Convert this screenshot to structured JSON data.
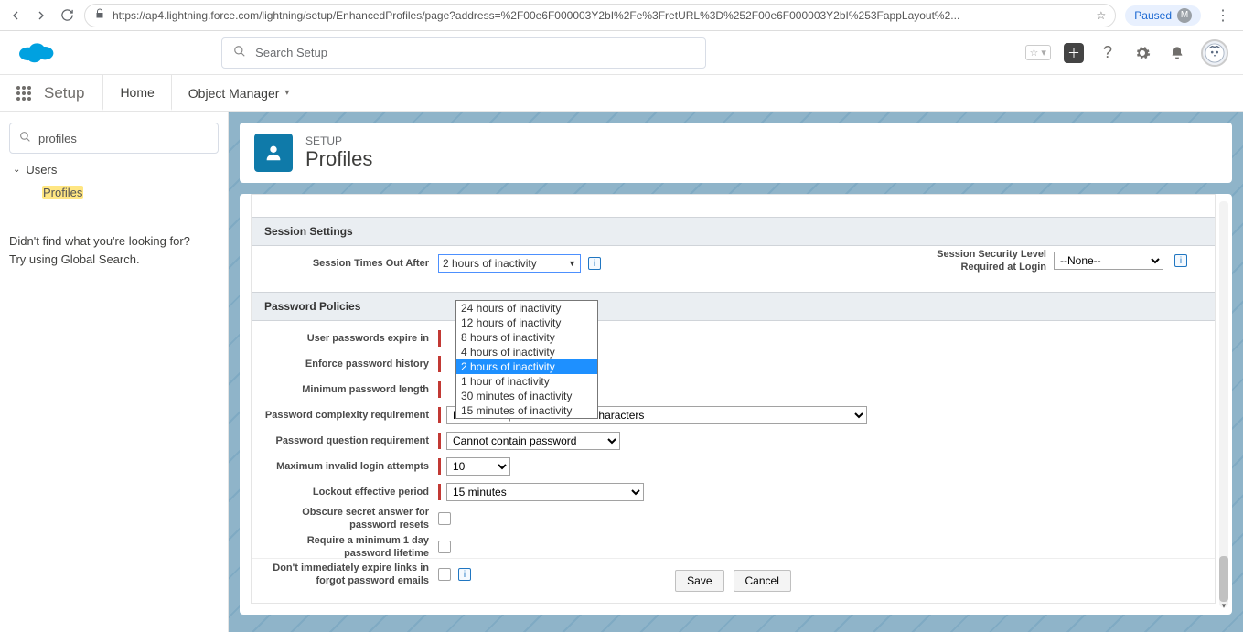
{
  "browser": {
    "url": "https://ap4.lightning.force.com/lightning/setup/EnhancedProfiles/page?address=%2F00e6F000003Y2bI%2Fe%3FretURL%3D%252F00e6F000003Y2bI%253FappLayout%2...",
    "paused": "Paused",
    "avatar_letter": "M"
  },
  "header": {
    "search_placeholder": "Search Setup"
  },
  "tabs": {
    "app_label": "Setup",
    "home": "Home",
    "object_manager": "Object Manager"
  },
  "sidebar": {
    "quickfind": "profiles",
    "users": "Users",
    "profiles": "Profiles",
    "footer1": "Didn't find what you're looking for?",
    "footer2": "Try using Global Search."
  },
  "page": {
    "sup": "SETUP",
    "title": "Profiles"
  },
  "sections": {
    "session": "Session Settings",
    "password": "Password Policies"
  },
  "session": {
    "timeout_label": "Session Times Out After",
    "timeout_selected": "2 hours of inactivity",
    "timeout_options": {
      "o1": "24 hours of inactivity",
      "o2": "12 hours of inactivity",
      "o3": "8 hours of inactivity",
      "o4": "4 hours of inactivity",
      "o5": "2 hours of inactivity",
      "o6": "1 hour of inactivity",
      "o7": "30 minutes of inactivity",
      "o8": "15 minutes of inactivity"
    },
    "security_label": "Session Security Level Required at Login",
    "security_value": "--None--"
  },
  "password": {
    "expire_label": "User passwords expire in",
    "enforce_label": "Enforce password history",
    "minlen_label": "Minimum password length",
    "complexity_label": "Password complexity requirement",
    "complexity_value": "Must mix alpha and numeric characters",
    "question_label": "Password question requirement",
    "question_value": "Cannot contain password",
    "maxinvalid_label": "Maximum invalid login attempts",
    "maxinvalid_value": "10",
    "lockout_label": "Lockout effective period",
    "lockout_value": "15 minutes",
    "obscure_label": "Obscure secret answer for password resets",
    "minday_label": "Require a minimum 1 day password lifetime",
    "noexpire_label": "Don't immediately expire links in forgot password emails"
  },
  "buttons": {
    "save": "Save",
    "cancel": "Cancel"
  }
}
